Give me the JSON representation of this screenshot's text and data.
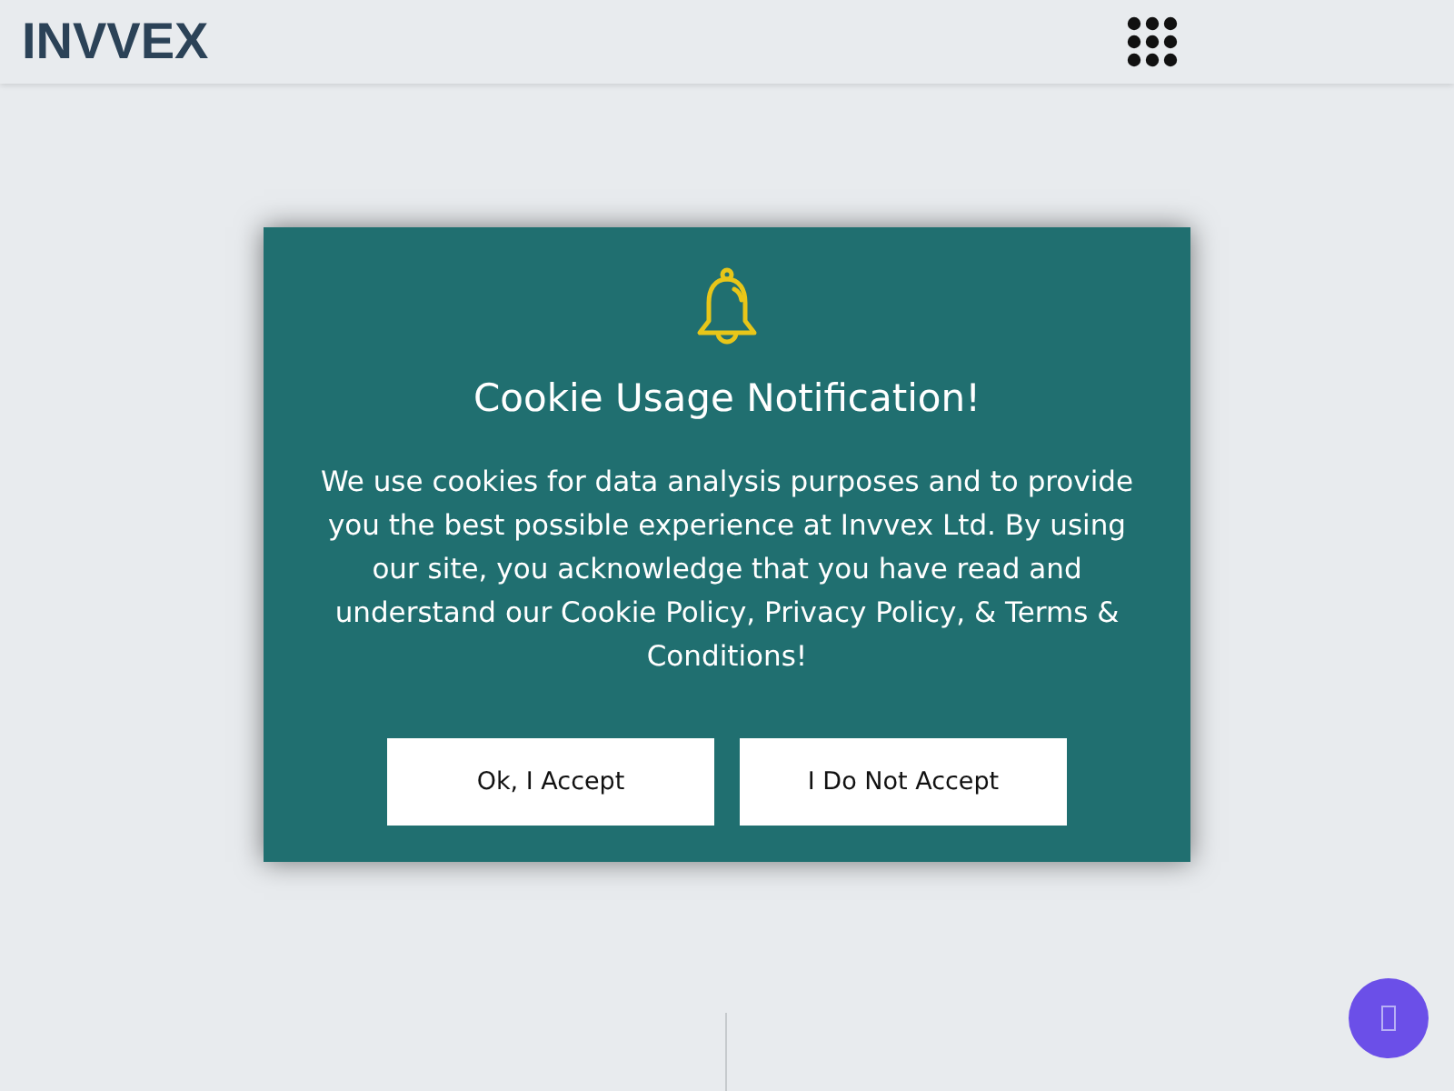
{
  "header": {
    "logo": "INVVEX"
  },
  "dialog": {
    "title": "Cookie Usage Notification!",
    "message": "We use cookies for data analysis purposes and to provide you the best possible experience at Invvex Ltd. By using our site, you acknowledge that you have read and understand our Cookie Policy, Privacy Policy, & Terms & Conditions!",
    "buttons": [
      "Ok, I Accept",
      "I Do Not Accept"
    ]
  }
}
